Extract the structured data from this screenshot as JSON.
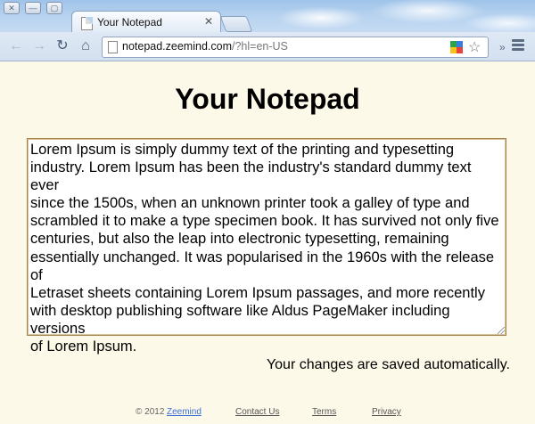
{
  "window": {
    "close_glyph": "✕",
    "minimize_glyph": "—",
    "maximize_glyph": "▢"
  },
  "tab": {
    "title": "Your Notepad",
    "close_glyph": "✕"
  },
  "toolbar": {
    "back_icon": "left-arrow-icon",
    "forward_icon": "right-arrow-icon",
    "reload_icon": "reload-icon",
    "home_icon": "home-icon",
    "url_host": "notepad.zeemind.com",
    "url_path": "/?hl=en-US"
  },
  "page": {
    "heading": "Your Notepad",
    "note_text": "Lorem Ipsum is simply dummy text of the printing and typesetting\nindustry. Lorem Ipsum has been the industry's standard dummy text ever\nsince the 1500s, when an unknown printer took a galley of type and\nscrambled it to make a type specimen book. It has survived not only five\ncenturies, but also the leap into electronic typesetting, remaining\nessentially unchanged. It was popularised in the 1960s with the release of\nLetraset sheets containing Lorem Ipsum passages, and more recently\nwith desktop publishing software like Aldus PageMaker including versions\nof Lorem Ipsum.",
    "saved_message": "Your changes are saved automatically."
  },
  "footer": {
    "copyright": "© 2012",
    "brand": "Zeemind",
    "contact": "Contact Us",
    "terms": "Terms",
    "privacy": "Privacy"
  },
  "colors": {
    "page_background": "#fdf9e8",
    "textarea_border": "#a8844c",
    "brand_link": "#3b6fd8"
  }
}
